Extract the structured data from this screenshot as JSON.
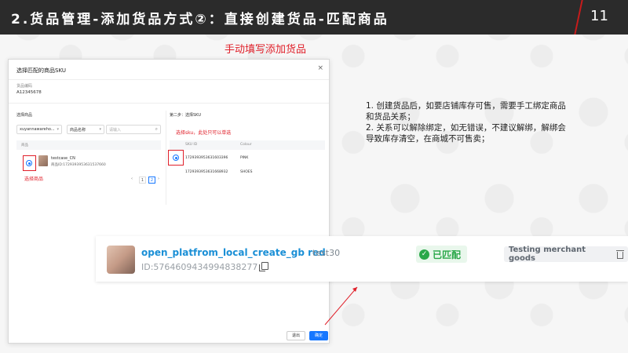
{
  "header": {
    "title": "2.货品管理-添加货品方式②：直接创建货品-匹配商品",
    "page_number": "11"
  },
  "annotation_top": "手动填写添加货品",
  "dialog": {
    "title": "选择匹配的商品SKU",
    "close_glyph": "×",
    "goods_code_label": "货品编码",
    "goods_code_value": "A12345678",
    "left": {
      "section_label": "选择商品",
      "warehouse_select": "xuyannawareho...",
      "field_select": "商品名称",
      "search_placeholder": "请输入",
      "column_header": "商品",
      "product_name": "testcase_CN",
      "product_id": "商品ID:1729393953631537660",
      "annotation": "选择商品",
      "pages": [
        "1",
        "2"
      ]
    },
    "right": {
      "section_label": "第二步：选择SKU",
      "annotation": "选择sku，此处只可以单选",
      "columns": [
        "SKU ID",
        "Colour"
      ],
      "rows": [
        {
          "sku_id": "1729393953631603396",
          "colour": "PINK",
          "selected": true
        },
        {
          "sku_id": "1729393953631668932",
          "colour": "SHOES",
          "selected": false
        }
      ]
    },
    "cancel_label": "退出",
    "ok_label": "确定"
  },
  "banner": {
    "product_name": "open_platfrom_local_create_gb red",
    "product_id": "ID:5764609434994838277",
    "store": "test30",
    "match_status": "已匹配",
    "merchant": "Testing merchant goods"
  },
  "note": {
    "line1": "1. 创建货品后，如要店铺库存可售，需要手工绑定商品和货品关系；",
    "line2": "2. 关系可以解除绑定，如无错误，不建议解绑，解绑会导致库存清空，在商城不可售卖；"
  },
  "colors": {
    "accent_red": "#e0202a",
    "primary_blue": "#1677ff",
    "match_green": "#2aa84a",
    "header_dark": "#2b2b2b"
  }
}
